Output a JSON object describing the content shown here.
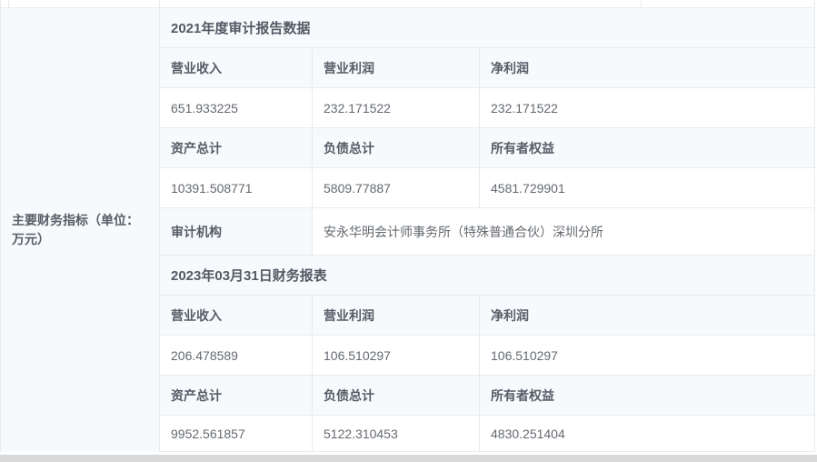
{
  "colors": {
    "border": "#e8ebee",
    "tint_row_bg": "#f7fafd",
    "bold_text": "#555d66",
    "value_text": "#64696f",
    "bottom_bar": "#d9d9d9"
  },
  "row_label": "主要财务指标（单位：万元）",
  "sections": [
    {
      "title": "2021年度审计报告数据",
      "rows": [
        {
          "type": "header",
          "cells": [
            "营业收入",
            "营业利润",
            "净利润"
          ]
        },
        {
          "type": "value",
          "cells": [
            "651.933225",
            "232.171522",
            "232.171522"
          ]
        },
        {
          "type": "header",
          "cells": [
            "资产总计",
            "负债总计",
            "所有者权益"
          ]
        },
        {
          "type": "value",
          "cells": [
            "10391.508771",
            "5809.77887",
            "4581.729901"
          ]
        }
      ],
      "audit": {
        "label": "审计机构",
        "value": "安永华明会计师事务所（特殊普通合伙）深圳分所"
      }
    },
    {
      "title": "2023年03月31日财务报表",
      "rows": [
        {
          "type": "header",
          "cells": [
            "营业收入",
            "营业利润",
            "净利润"
          ]
        },
        {
          "type": "value",
          "cells": [
            "206.478589",
            "106.510297",
            "106.510297"
          ]
        },
        {
          "type": "header",
          "cells": [
            "资产总计",
            "负债总计",
            "所有者权益"
          ]
        },
        {
          "type": "value",
          "cells": [
            "9952.561857",
            "5122.310453",
            "4830.251404"
          ]
        }
      ]
    }
  ]
}
